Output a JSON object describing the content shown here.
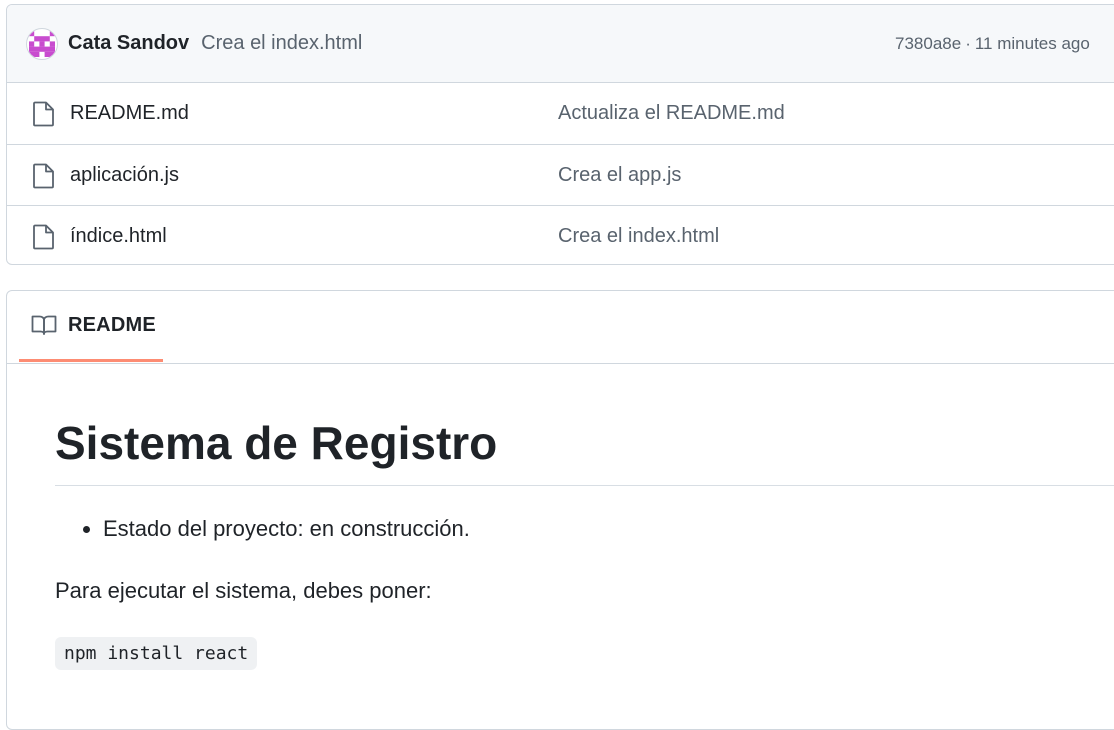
{
  "commit": {
    "author": "Cata Sandov",
    "message": "Crea el index.html",
    "hash": "7380a8e",
    "separator": "·",
    "time": "11 minutes ago"
  },
  "files": [
    {
      "name": "README.md",
      "commit_message": "Actualiza el README.md",
      "icon": "file-icon"
    },
    {
      "name": "aplicación.js",
      "commit_message": "Crea el app.js",
      "icon": "file-icon"
    },
    {
      "name": "índice.html",
      "commit_message": "Crea el index.html",
      "icon": "file-icon"
    }
  ],
  "readme": {
    "tab_label": "README",
    "tab_icon": "book-icon",
    "title": "Sistema de Registro",
    "list_items": [
      "Estado del proyecto: en construcción."
    ],
    "paragraph": "Para ejecutar el sistema, debes poner:",
    "code": "npm install react"
  },
  "colors": {
    "accent_underline": "#fd8c73",
    "avatar": "#c84ccf",
    "muted_text": "#59636e",
    "border": "#d0d7de"
  }
}
